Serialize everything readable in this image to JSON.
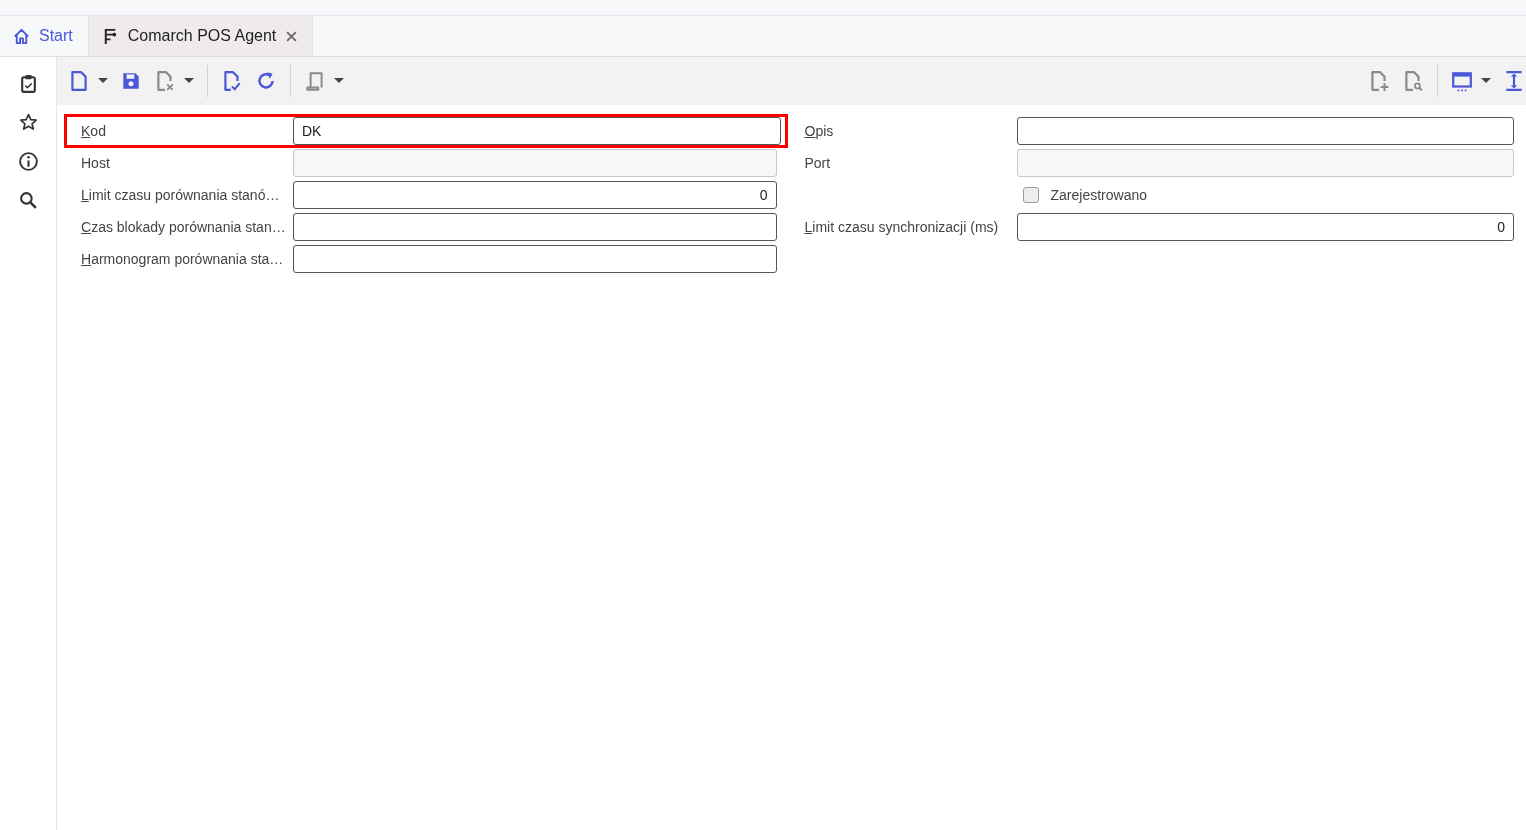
{
  "tabs": [
    {
      "kind": "home",
      "label": "Start",
      "selected": false
    },
    {
      "kind": "document",
      "label": "Comarch POS Agent",
      "selected": true,
      "closable": true
    }
  ],
  "toolbar": {
    "left": [
      {
        "kind": "button",
        "dropdown": true,
        "disabled": false
      },
      {
        "kind": "button",
        "dropdown": false,
        "disabled": false
      },
      {
        "kind": "button",
        "dropdown": true,
        "disabled": true
      },
      {
        "kind": "separator"
      },
      {
        "kind": "button",
        "dropdown": false,
        "disabled": false
      },
      {
        "kind": "button",
        "dropdown": false,
        "disabled": false
      },
      {
        "kind": "separator"
      },
      {
        "kind": "button",
        "dropdown": true,
        "disabled": true
      }
    ],
    "right": [
      {
        "kind": "button",
        "dropdown": false,
        "disabled": true
      },
      {
        "kind": "button",
        "dropdown": false,
        "disabled": true
      },
      {
        "kind": "separator"
      },
      {
        "kind": "button",
        "dropdown": true,
        "disabled": false
      },
      {
        "kind": "button",
        "dropdown": false,
        "disabled": false
      }
    ]
  },
  "form": {
    "left": [
      {
        "kind": "text",
        "label": "Kod",
        "underline_first": true,
        "value": "DK",
        "disabled": false,
        "highlighted": true
      },
      {
        "kind": "text",
        "label": "Host",
        "underline_first": false,
        "disabled": true
      },
      {
        "kind": "number",
        "label": "Limit czasu porównania stanó…",
        "underline_first": true,
        "value": "0",
        "disabled": false
      },
      {
        "kind": "text",
        "label": "Czas blokady porównania stan…",
        "underline_first": true,
        "disabled": false
      },
      {
        "kind": "text",
        "label": "Harmonogram porównania sta…",
        "underline_first": true,
        "disabled": false
      }
    ],
    "right": [
      {
        "kind": "text",
        "label": "Opis",
        "underline_first": true,
        "disabled": false
      },
      {
        "kind": "text",
        "label": "Port",
        "underline_first": false,
        "disabled": true
      },
      {
        "kind": "checkbox",
        "label": "Zarejestrowano",
        "checked": false
      },
      {
        "kind": "number",
        "label": "Limit czasu synchronizacji (ms)",
        "underline_first": true,
        "value": "0",
        "disabled": false
      }
    ]
  }
}
